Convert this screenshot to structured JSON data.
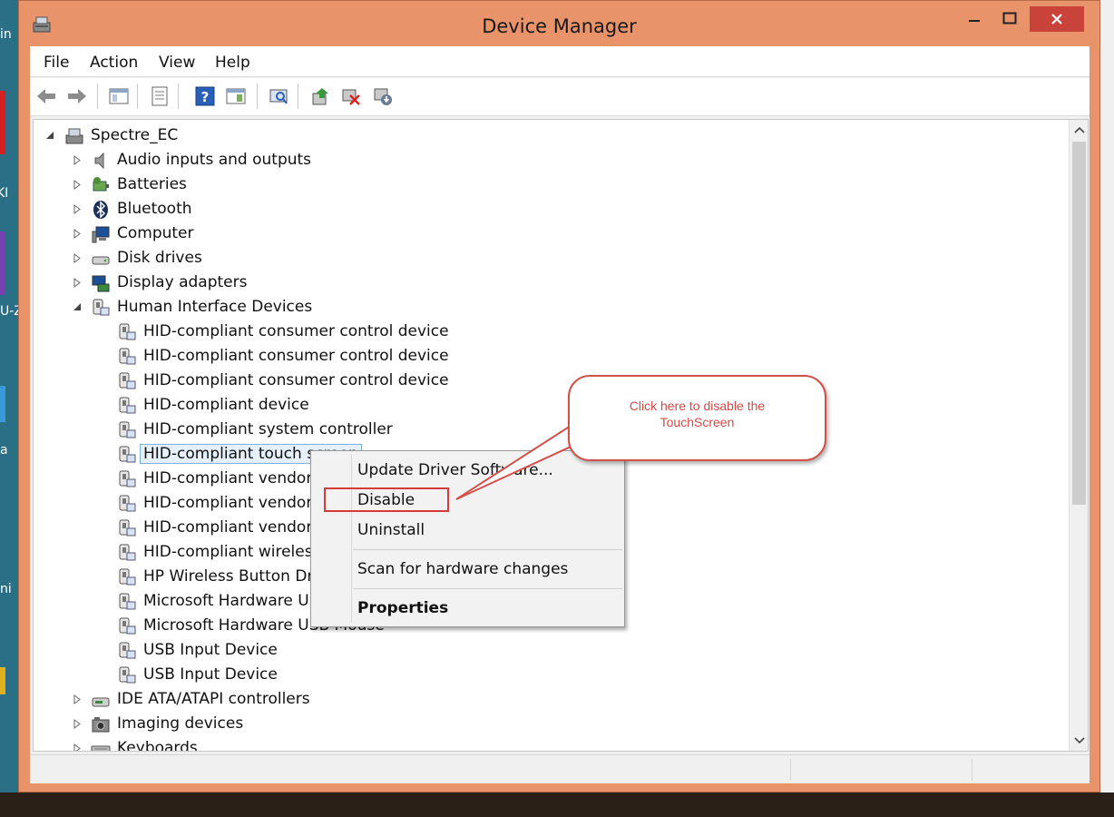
{
  "window": {
    "title": "Device Manager",
    "title_color": "#e9936a",
    "close_color": "#c9433a"
  },
  "desktop": {
    "edge_texts": [
      "in",
      "KI",
      "U-Z",
      "a",
      "ni"
    ]
  },
  "menu": {
    "file": "File",
    "action": "Action",
    "view": "View",
    "help": "Help"
  },
  "toolbar": {
    "icons": [
      "back-arrow-icon",
      "forward-arrow-icon",
      "show-hide-console-tree-icon",
      "properties-icon",
      "help-icon",
      "view-icon",
      "scan-hardware-icon",
      "update-driver-icon",
      "uninstall-icon",
      "disable-device-icon"
    ]
  },
  "tree": {
    "root": "Spectre_EC",
    "categories_top": [
      {
        "label": "Audio inputs and outputs",
        "icon": "speaker-icon"
      },
      {
        "label": "Batteries",
        "icon": "battery-icon"
      },
      {
        "label": "Bluetooth",
        "icon": "bluetooth-icon"
      },
      {
        "label": "Computer",
        "icon": "computer-icon"
      },
      {
        "label": "Disk drives",
        "icon": "disk-drive-icon"
      },
      {
        "label": "Display adapters",
        "icon": "display-adapter-icon"
      }
    ],
    "hid_category": "Human Interface Devices",
    "hid_children": [
      "HID-compliant consumer control device",
      "HID-compliant consumer control device",
      "HID-compliant consumer control device",
      "HID-compliant device",
      "HID-compliant system controller",
      "HID-compliant touch screen",
      "HID-compliant vendor-",
      "HID-compliant vendor-",
      "HID-compliant vendor-",
      "HID-compliant wireless",
      "HP Wireless Button Driv",
      "Microsoft Hardware US",
      "Microsoft Hardware USB Mouse",
      "USB Input Device",
      "USB Input Device"
    ],
    "selected_index": 5,
    "categories_bottom": [
      {
        "label": "IDE ATA/ATAPI controllers",
        "icon": "ide-controller-icon"
      },
      {
        "label": "Imaging devices",
        "icon": "camera-icon"
      },
      {
        "label": "Keyboards",
        "icon": "keyboard-icon"
      }
    ]
  },
  "context_menu": {
    "update": "Update Driver Software...",
    "disable": "Disable",
    "uninstall": "Uninstall",
    "scan": "Scan for hardware changes",
    "properties": "Properties"
  },
  "callout": {
    "text": "Click here to disable the TouchScreen",
    "color": "#d24a44"
  }
}
